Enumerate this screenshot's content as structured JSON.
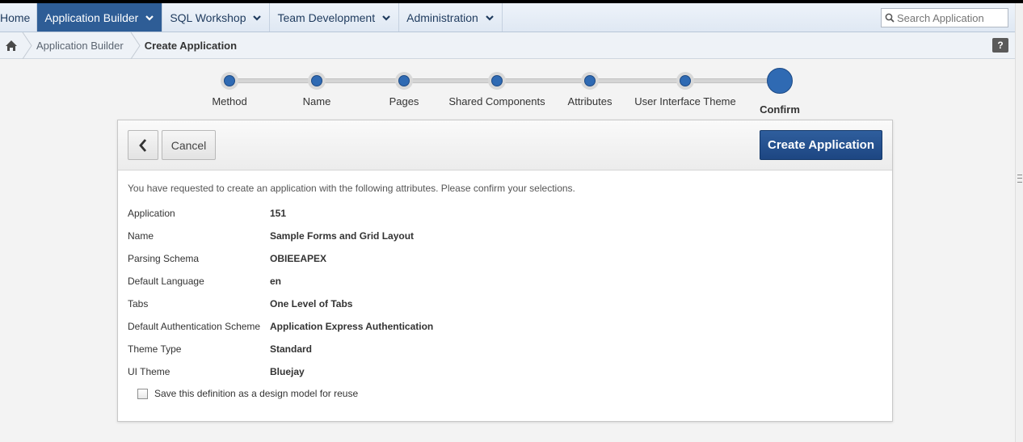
{
  "topnav": {
    "items": [
      {
        "label": "Home"
      },
      {
        "label": "Application Builder"
      },
      {
        "label": "SQL Workshop"
      },
      {
        "label": "Team Development"
      },
      {
        "label": "Administration"
      }
    ],
    "active_index": 1,
    "search_placeholder": "Search Application",
    "search_icon": "search-icon"
  },
  "breadcrumb": {
    "home_icon": "home-icon",
    "items": [
      "Application Builder",
      "Create Application"
    ],
    "help_label": "?"
  },
  "wizard": {
    "steps": [
      "Method",
      "Name",
      "Pages",
      "Shared Components",
      "Attributes",
      "User Interface Theme",
      "Confirm"
    ],
    "current_index": 6
  },
  "panel": {
    "back_icon": "chevron-left-icon",
    "cancel_label": "Cancel",
    "create_label": "Create Application",
    "intro": "You have requested to create an application with the following attributes. Please confirm your selections.",
    "attributes": [
      {
        "label": "Application",
        "value": "151"
      },
      {
        "label": "Name",
        "value": "Sample Forms and Grid Layout"
      },
      {
        "label": "Parsing Schema",
        "value": "OBIEEAPEX"
      },
      {
        "label": "Default Language",
        "value": "en"
      },
      {
        "label": "Tabs",
        "value": "One Level of Tabs"
      },
      {
        "label": "Default Authentication Scheme",
        "value": "Application Express Authentication"
      },
      {
        "label": "Theme Type",
        "value": "Standard"
      },
      {
        "label": "UI Theme",
        "value": "Bluejay"
      }
    ],
    "save_label": "Save this definition as a design model for reuse",
    "save_checked": false
  },
  "colors": {
    "nav_active": "#2e5d96",
    "primary_button": "#1d4682",
    "wizard_dot": "#2f6ab3"
  }
}
